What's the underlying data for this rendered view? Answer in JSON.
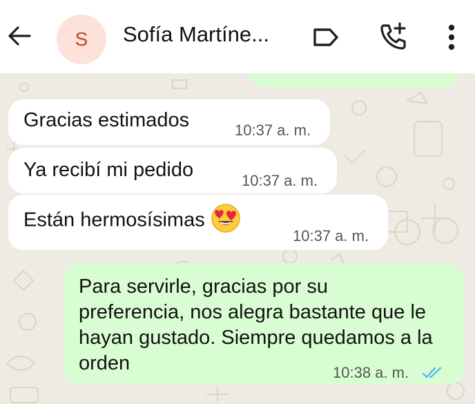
{
  "header": {
    "avatar_initial": "S",
    "contact_name": "Sofía Martíne...",
    "icons": [
      "back-arrow-icon",
      "label-icon",
      "add-call-icon",
      "more-vert-icon"
    ]
  },
  "messages": [
    {
      "direction": "incoming",
      "text": "Gracias estimados",
      "time": "10:37 a. m."
    },
    {
      "direction": "incoming",
      "text": "Ya recibí mi pedido",
      "time": "10:37 a. m."
    },
    {
      "direction": "incoming",
      "text": "Están hermosísimas",
      "emoji": "heart-eyes-emoji",
      "time": "10:37 a. m."
    },
    {
      "direction": "outgoing",
      "text": "Para servirle, gracias por su preferencia, nos alegra bastante que le hayan gustado. Siempre quedamos a la orden",
      "time": "10:38 a. m.",
      "status": "read-double-check"
    }
  ],
  "colors": {
    "header_bg": "#ffffff",
    "chat_bg": "#efeae2",
    "incoming_bubble": "#ffffff",
    "outgoing_bubble": "#d9fdd3",
    "avatar_bg": "#fde2d9",
    "avatar_text": "#c0462a",
    "read_tick": "#53bdeb"
  }
}
